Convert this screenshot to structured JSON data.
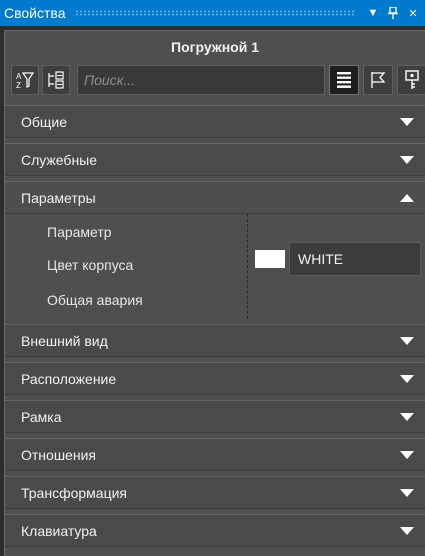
{
  "window": {
    "title": "Свойства"
  },
  "object": {
    "title": "Погружной 1"
  },
  "search": {
    "placeholder": "Поиск..."
  },
  "toolbar": {
    "buttons": [
      {
        "icon": "filter-sort-icon"
      },
      {
        "icon": "tree-collapse-icon"
      }
    ],
    "view_buttons": [
      {
        "icon": "list-view-icon",
        "active": true
      },
      {
        "icon": "flag-icon"
      },
      {
        "icon": "key-icon"
      }
    ]
  },
  "sections": {
    "general": "Общие",
    "service": "Служебные",
    "parameters": "Параметры",
    "appearance": "Внешний вид",
    "location": "Расположение",
    "frame": "Рамка",
    "relations": "Отношения",
    "transformation": "Трансформация",
    "keyboard": "Клавиатура"
  },
  "parameters": {
    "param_label": "Параметр",
    "body_color_label": "Цвет корпуса",
    "body_color_value": "WHITE",
    "body_color_hex": "#ffffff",
    "alarm_label": "Общая авария"
  },
  "colors": {
    "titlebar": "#007acc",
    "panel": "#4f4f4f"
  }
}
